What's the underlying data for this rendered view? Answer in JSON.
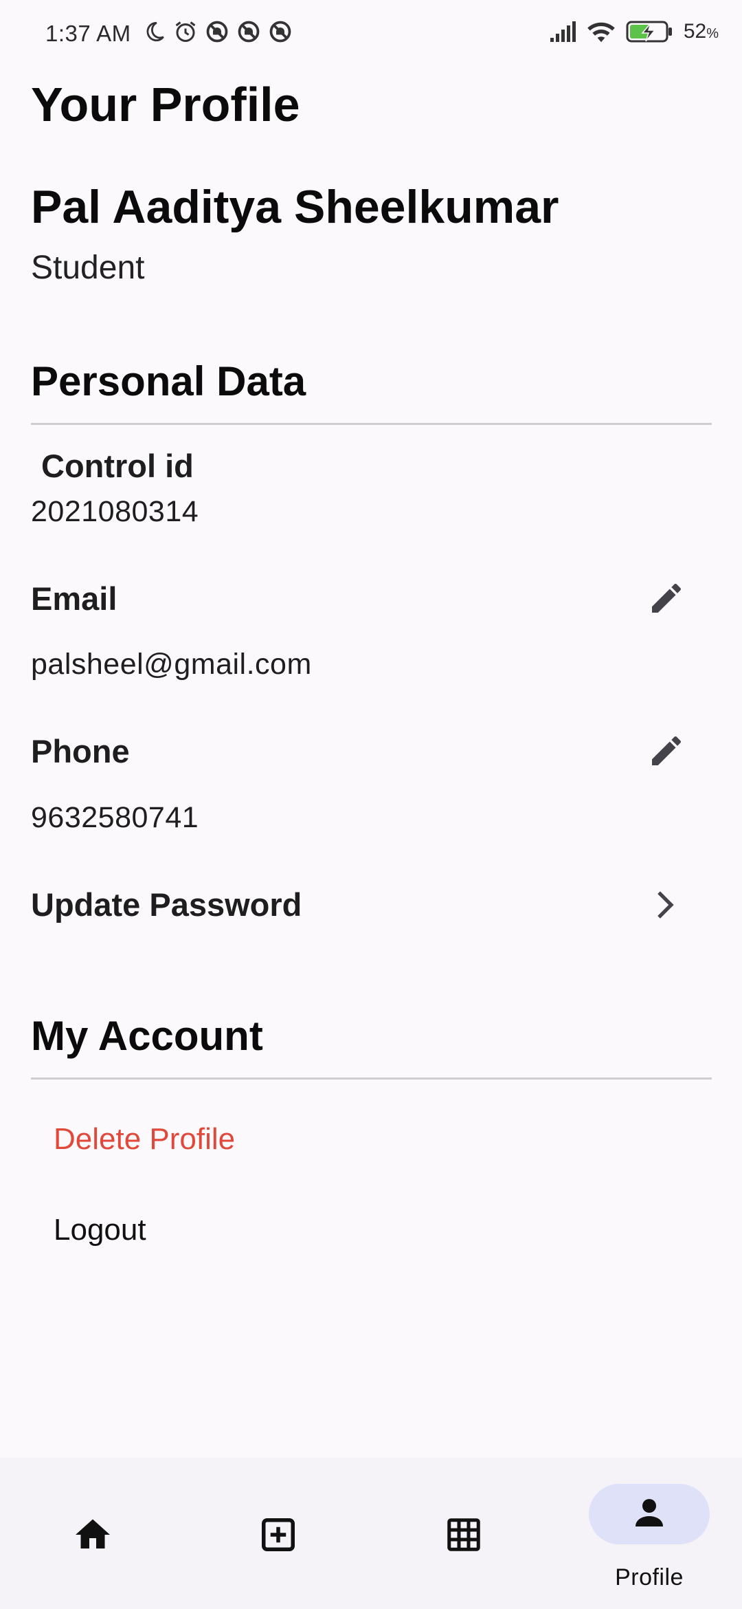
{
  "status_bar": {
    "time": "1:37 AM",
    "battery_percent": "52",
    "battery_unit": "%",
    "icons_left": [
      "moon-icon",
      "alarm-icon",
      "blocked-notification-icon",
      "blocked-notification-icon",
      "blocked-notification-icon"
    ],
    "icons_right": [
      "signal-icon",
      "wifi-icon",
      "battery-charging-icon"
    ]
  },
  "page": {
    "title": "Your Profile"
  },
  "profile": {
    "name": "Pal Aaditya Sheelkumar",
    "role": "Student"
  },
  "personal_data": {
    "title": "Personal Data",
    "control_id": {
      "label": "Control id",
      "value": "2021080314"
    },
    "email": {
      "label": "Email",
      "value": "palsheel@gmail.com",
      "icon": "edit-icon"
    },
    "phone": {
      "label": "Phone",
      "value": "9632580741",
      "icon": "edit-icon"
    },
    "update_password": {
      "label": "Update Password",
      "icon": "chevron-right-icon"
    }
  },
  "my_account": {
    "title": "My Account",
    "delete_label": "Delete Profile",
    "logout_label": "Logout"
  },
  "bottom_nav": {
    "items": [
      {
        "icon": "home-icon",
        "label": ""
      },
      {
        "icon": "add-box-icon",
        "label": ""
      },
      {
        "icon": "grid-icon",
        "label": ""
      },
      {
        "icon": "person-icon",
        "label": "Profile",
        "active": true
      }
    ]
  },
  "colors": {
    "background": "#fcf9fd",
    "danger": "#e0483a",
    "nav_active_indicator": "#dfe1f8",
    "divider": "#cfcdd2"
  }
}
